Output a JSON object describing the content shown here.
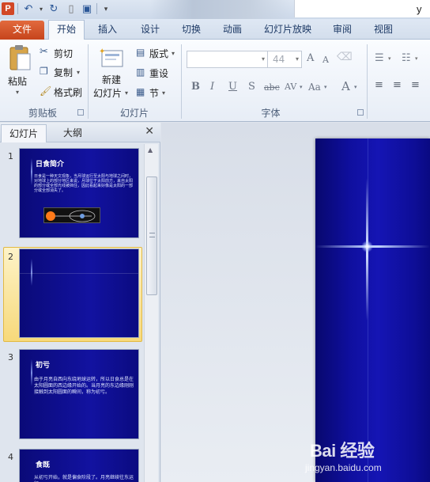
{
  "app": {
    "logo": "P",
    "title_fragment": "y"
  },
  "tabs": [
    {
      "label": "文件"
    },
    {
      "label": "开始"
    },
    {
      "label": "插入"
    },
    {
      "label": "设计"
    },
    {
      "label": "切换"
    },
    {
      "label": "动画"
    },
    {
      "label": "幻灯片放映"
    },
    {
      "label": "审阅"
    },
    {
      "label": "视图"
    }
  ],
  "ribbon": {
    "clipboard": {
      "paste": "粘贴",
      "cut": "剪切",
      "copy": "复制",
      "format_painter": "格式刷",
      "group": "剪贴板"
    },
    "slides": {
      "new_line1": "新建",
      "new_line2": "幻灯片",
      "layout": "版式",
      "reset": "重设",
      "section": "节",
      "group": "幻灯片"
    },
    "font": {
      "size": "44",
      "group": "字体",
      "bold": "B",
      "italic": "I",
      "underline": "U",
      "shadow": "S",
      "strike": "abc",
      "spacing": "AV",
      "case": "Aa",
      "color": "A",
      "grow": "A",
      "shrink": "A"
    }
  },
  "panel": {
    "tab_slides": "幻灯片",
    "tab_outline": "大纲",
    "close": "✕"
  },
  "slides": [
    {
      "num": "1",
      "title": "日食简介",
      "body": "日食是一种天文现象，当月球运行至太阳与地球之间时，对地球上的部分地区来说，月球位于太阳前方，来自太阳的部分或全部光线被挡住，因此看起来好像是太阳的一部分或全部消失了。"
    },
    {
      "num": "2",
      "title": "",
      "body": ""
    },
    {
      "num": "3",
      "title": "初亏",
      "body": "由于月亮自西向东绕地球运转，所以日食总是在太阳圆面的西边缘开始的。当月亮的东边缘刚刚接触到太阳圆面的瞬间，称为初亏。"
    },
    {
      "num": "4",
      "title": "食既",
      "body": "从初亏开始，就是偏食阶段了。月亮继续往东运行"
    }
  ],
  "watermark": {
    "logo": "Bai 经验",
    "url": "jingyan.baidu.com"
  }
}
